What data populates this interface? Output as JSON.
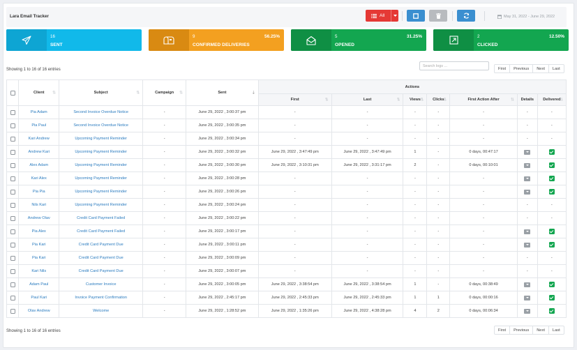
{
  "app": {
    "title": "Lara Email Tracker",
    "filter_label": "All",
    "date_range": "May 31, 2022 - June 29, 2022"
  },
  "cards": [
    {
      "count": "16",
      "label": "SENT",
      "percent": "",
      "icon": "paper-plane-icon",
      "color": "#11b9ea"
    },
    {
      "count": "9",
      "label": "CONFIRMED DELIVERIES",
      "percent": "56.25%",
      "icon": "mailbox-icon",
      "color": "#f3a020"
    },
    {
      "count": "5",
      "label": "OPENED",
      "percent": "31.25%",
      "icon": "envelope-open-icon",
      "color": "#13a650"
    },
    {
      "count": "2",
      "label": "CLICKED",
      "percent": "12.50%",
      "icon": "external-link-icon",
      "color": "#13a650"
    }
  ],
  "table_info_top": "Showing 1 to 16 of 16 entries",
  "table_info_bottom": "Showing 1 to 16 of 16 entries",
  "search": {
    "placeholder": "Search logs ..."
  },
  "pagination": [
    "First",
    "Previous",
    "Next",
    "Last"
  ],
  "actions_header": "Actions",
  "columns": [
    "Client",
    "Subject",
    "Campaign",
    "Sent",
    "First",
    "Last",
    "Views",
    "Clicks",
    "First Action After",
    "Details",
    "Delivered"
  ],
  "rows": [
    {
      "client": "Pia Adam",
      "subject": "Second Invoice Overdue Notice",
      "campaign": "-",
      "sent": "June 29, 2022 , 3:00:37 pm",
      "first": "-",
      "last": "-",
      "views": "-",
      "clicks": "-",
      "after": "-",
      "details": false,
      "delivered": false
    },
    {
      "client": "Pia Paul",
      "subject": "Second Invoice Overdue Notice",
      "campaign": "-",
      "sent": "June 29, 2022 , 3:00:35 pm",
      "first": "-",
      "last": "-",
      "views": "-",
      "clicks": "-",
      "after": "-",
      "details": false,
      "delivered": false
    },
    {
      "client": "Kari Andrew",
      "subject": "Upcoming Payment Reminder",
      "campaign": "-",
      "sent": "June 29, 2022 , 3:00:34 pm",
      "first": "-",
      "last": "-",
      "views": "-",
      "clicks": "-",
      "after": "-",
      "details": false,
      "delivered": false
    },
    {
      "client": "Andrew Kari",
      "subject": "Upcoming Payment Reminder",
      "campaign": "-",
      "sent": "June 29, 2022 , 3:00:32 pm",
      "first": "June 29, 2022 , 3:47:49 pm",
      "last": "June 29, 2022 , 3:47:49 pm",
      "views": "1",
      "clicks": "-",
      "after": "0 days, 00:47:17",
      "details": true,
      "delivered": true
    },
    {
      "client": "Alex Adam",
      "subject": "Upcoming Payment Reminder",
      "campaign": "-",
      "sent": "June 29, 2022 , 3:00:30 pm",
      "first": "June 29, 2022 , 3:10:31 pm",
      "last": "June 29, 2022 , 3:31:17 pm",
      "views": "2",
      "clicks": "-",
      "after": "0 days, 00:10:01",
      "details": true,
      "delivered": true
    },
    {
      "client": "Kari Alex",
      "subject": "Upcoming Payment Reminder",
      "campaign": "-",
      "sent": "June 29, 2022 , 3:00:28 pm",
      "first": "-",
      "last": "-",
      "views": "-",
      "clicks": "-",
      "after": "-",
      "details": true,
      "delivered": true
    },
    {
      "client": "Pia Pia",
      "subject": "Upcoming Payment Reminder",
      "campaign": "-",
      "sent": "June 29, 2022 , 3:00:26 pm",
      "first": "-",
      "last": "-",
      "views": "-",
      "clicks": "-",
      "after": "-",
      "details": true,
      "delivered": true
    },
    {
      "client": "Nils Kari",
      "subject": "Upcoming Payment Reminder",
      "campaign": "-",
      "sent": "June 29, 2022 , 3:00:24 pm",
      "first": "-",
      "last": "-",
      "views": "-",
      "clicks": "-",
      "after": "-",
      "details": false,
      "delivered": false
    },
    {
      "client": "Andrew Olav",
      "subject": "Credit Card Payment Failed",
      "campaign": "-",
      "sent": "June 29, 2022 , 3:00:22 pm",
      "first": "-",
      "last": "-",
      "views": "-",
      "clicks": "-",
      "after": "-",
      "details": false,
      "delivered": false
    },
    {
      "client": "Pia Alex",
      "subject": "Credit Card Payment Failed",
      "campaign": "-",
      "sent": "June 29, 2022 , 3:00:17 pm",
      "first": "-",
      "last": "-",
      "views": "-",
      "clicks": "-",
      "after": "-",
      "details": true,
      "delivered": true
    },
    {
      "client": "Pia Kari",
      "subject": "Credit Card Payment Due",
      "campaign": "-",
      "sent": "June 29, 2022 , 3:00:11 pm",
      "first": "-",
      "last": "-",
      "views": "-",
      "clicks": "-",
      "after": "-",
      "details": true,
      "delivered": true
    },
    {
      "client": "Pia Kari",
      "subject": "Credit Card Payment Due",
      "campaign": "-",
      "sent": "June 29, 2022 , 3:00:09 pm",
      "first": "-",
      "last": "-",
      "views": "-",
      "clicks": "-",
      "after": "-",
      "details": false,
      "delivered": false
    },
    {
      "client": "Kari Nils",
      "subject": "Credit Card Payment Due",
      "campaign": "-",
      "sent": "June 29, 2022 , 3:00:07 pm",
      "first": "-",
      "last": "-",
      "views": "-",
      "clicks": "-",
      "after": "-",
      "details": false,
      "delivered": false
    },
    {
      "client": "Adam Paul",
      "subject": "Customer Invoice",
      "campaign": "-",
      "sent": "June 29, 2022 , 3:00:05 pm",
      "first": "June 29, 2022 , 3:38:54 pm",
      "last": "June 29, 2022 , 3:38:54 pm",
      "views": "1",
      "clicks": "-",
      "after": "0 days, 00:38:49",
      "details": true,
      "delivered": true
    },
    {
      "client": "Paul Kari",
      "subject": "Invoice Payment Confirmation",
      "campaign": "-",
      "sent": "June 29, 2022 , 2:45:17 pm",
      "first": "June 29, 2022 , 2:45:33 pm",
      "last": "June 29, 2022 , 2:45:33 pm",
      "views": "1",
      "clicks": "1",
      "after": "0 days, 00:00:16",
      "details": true,
      "delivered": true
    },
    {
      "client": "Olav Andrew",
      "subject": "Welcome",
      "campaign": "-",
      "sent": "June 29, 2022 , 1:28:52 pm",
      "first": "June 29, 2022 , 1:35:26 pm",
      "last": "June 29, 2022 , 4:38:28 pm",
      "views": "4",
      "clicks": "2",
      "after": "0 days, 00:06:34",
      "details": true,
      "delivered": true
    }
  ]
}
